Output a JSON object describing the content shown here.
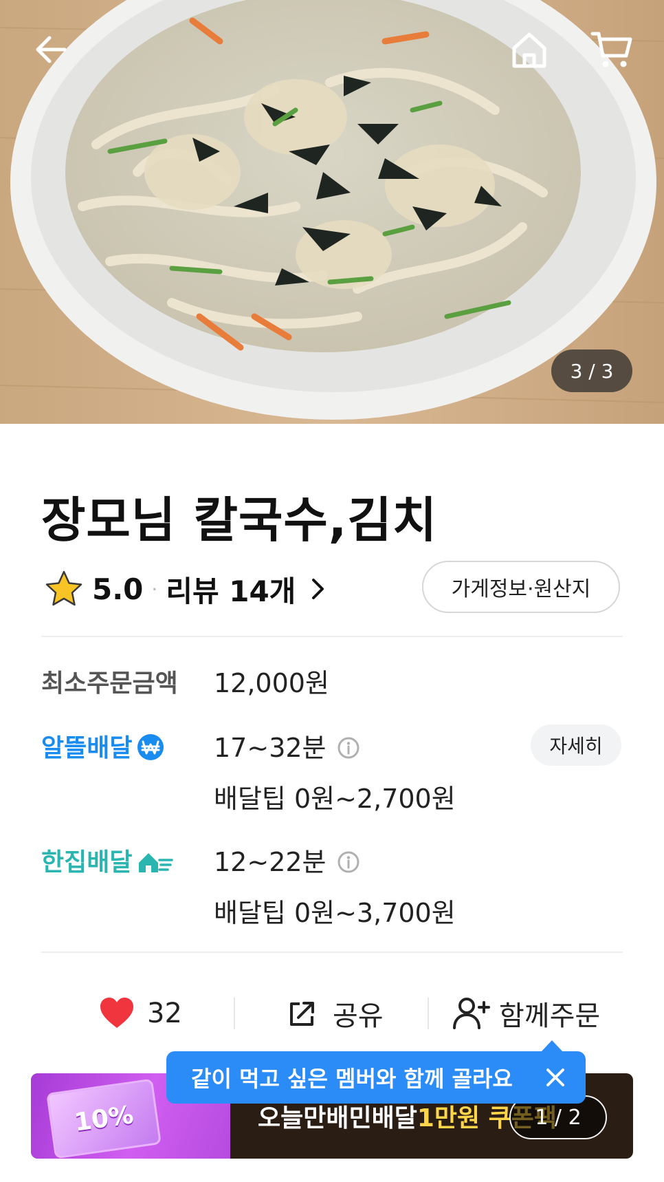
{
  "hero": {
    "counter": "3 / 3",
    "icons": [
      "back-arrow-icon",
      "home-icon",
      "cart-icon"
    ]
  },
  "store": {
    "title": "장모님 칼국수,김치",
    "rating": "5.0",
    "separator": "·",
    "reviews": "리뷰 14개",
    "info_button": "가게정보·원산지"
  },
  "order": {
    "min_label": "최소주문금액",
    "min_value": "12,000원",
    "saver": {
      "label": "알뜰배달",
      "time": "17~32분",
      "tip": "배달팁 0원~2,700원",
      "detail_button": "자세히"
    },
    "single": {
      "label": "한집배달",
      "time": "12~22분",
      "tip": "배달팁 0원~3,700원"
    }
  },
  "actions": {
    "likes": "32",
    "share": "공유",
    "group_order": "함께주문"
  },
  "tooltip": {
    "text": "같이 먹고 싶은 멤버와 함께 골라요"
  },
  "banner": {
    "ticket_text": "10%",
    "text_prefix": "오늘만 ",
    "text_brand": "배민배달 ",
    "text_highlight": "1만원 쿠폰팩",
    "page": "1 / 2"
  },
  "colors": {
    "saver_blue": "#1a8cf0",
    "single_teal": "#2bb5b0",
    "like_red": "#f0353f",
    "tooltip_blue": "#2b8cf7",
    "banner_yellow": "#ffd54a"
  }
}
